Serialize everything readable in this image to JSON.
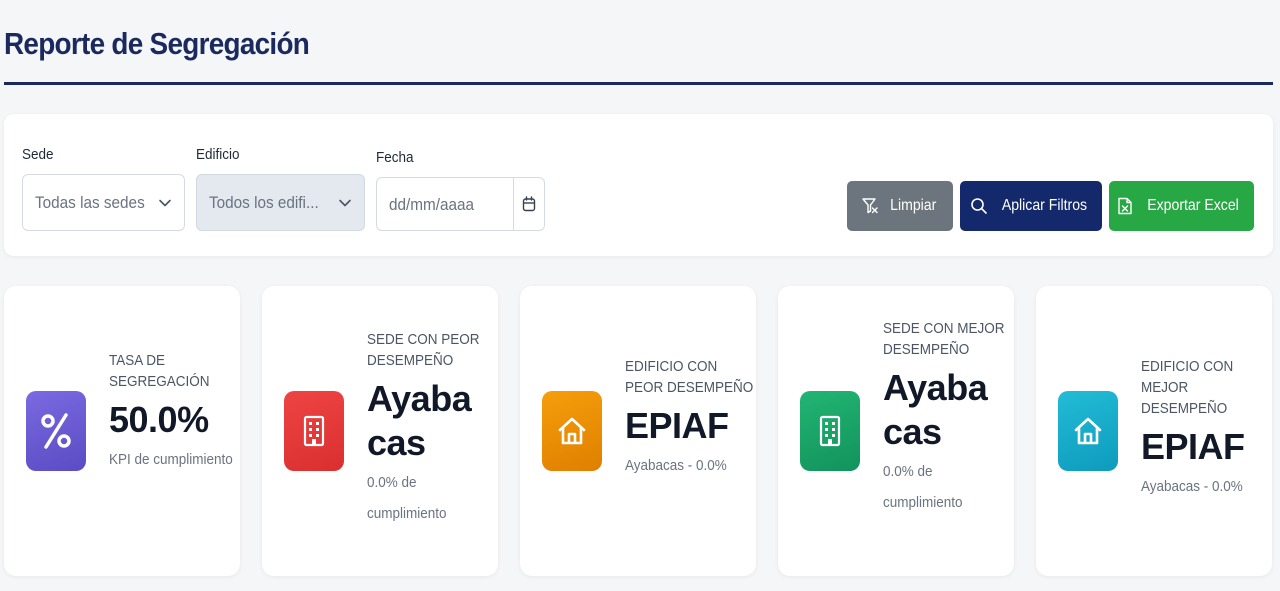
{
  "header": {
    "title": "Reporte de Segregación"
  },
  "filters": {
    "sede": {
      "label": "Sede",
      "value": "Todas las sedes"
    },
    "edificio": {
      "label": "Edificio",
      "value": "Todos los edifi..."
    },
    "fecha": {
      "label": "Fecha",
      "placeholder": "dd/mm/aaaa"
    }
  },
  "actions": {
    "clear_label": "Limpiar",
    "apply_label": "Aplicar Filtros",
    "export_label": "Exportar Excel"
  },
  "kpis": [
    {
      "label": "TASA DE SEGREGACIÓN",
      "value": "50.0%",
      "sub": "KPI de cumplimiento",
      "icon": "percent-icon",
      "color": "#6d5dd3"
    },
    {
      "label": "SEDE CON PEOR DESEMPEÑO",
      "value": "Ayabacas",
      "sub": "0.0% de cumplimiento",
      "icon": "building-icon",
      "color": "#e53939"
    },
    {
      "label": "EDIFICIO CON PEOR DESEMPEÑO",
      "value": "EPIAF",
      "sub": "Ayabacas - 0.0%",
      "icon": "home-icon",
      "color": "#f08c00"
    },
    {
      "label": "SEDE CON MEJOR DESEMPEÑO",
      "value": "Ayabacas",
      "sub": "0.0% de cumplimiento",
      "icon": "building-icon",
      "color": "#1aa56b"
    },
    {
      "label": "EDIFICIO CON MEJOR DESEMPEÑO",
      "value": "EPIAF",
      "sub": "Ayabacas - 0.0%",
      "icon": "home-icon",
      "color": "#17a9c9"
    }
  ]
}
